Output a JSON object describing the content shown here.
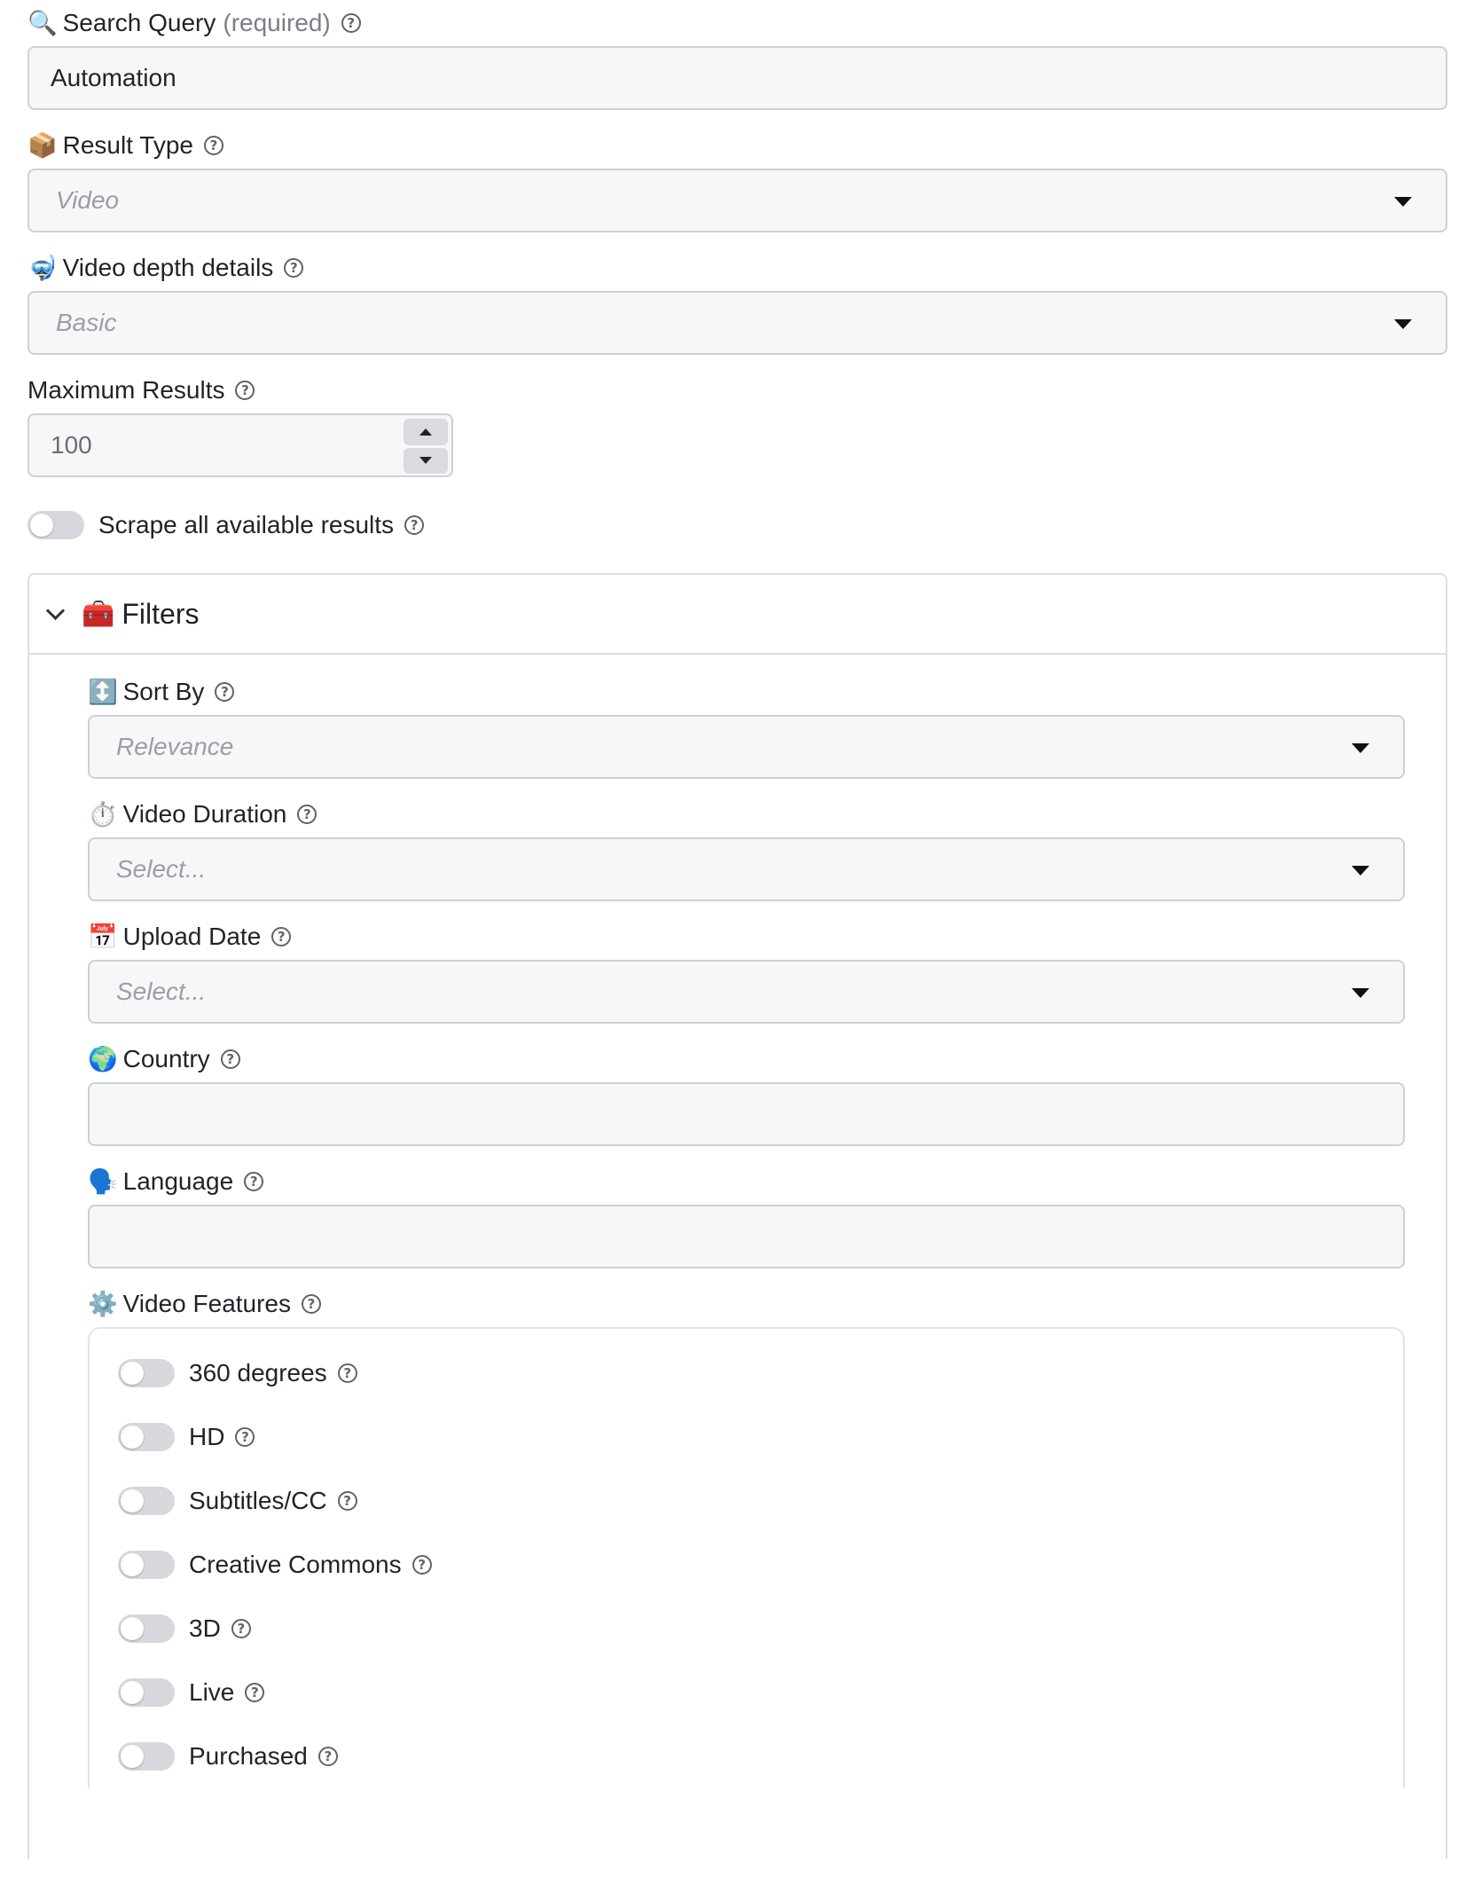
{
  "search_query": {
    "icon": "🔍",
    "label": "Search Query",
    "required_text": "(required)",
    "value": "Automation"
  },
  "result_type": {
    "icon": "📦",
    "label": "Result Type",
    "placeholder": "Video"
  },
  "video_depth": {
    "icon": "🤿",
    "label": "Video depth details",
    "placeholder": "Basic"
  },
  "max_results": {
    "label": "Maximum Results",
    "value": "100"
  },
  "scrape_all": {
    "label": "Scrape all available results",
    "enabled": false
  },
  "filters": {
    "icon": "🧰",
    "title": "Filters",
    "sort_by": {
      "icon": "↕️",
      "label": "Sort By",
      "placeholder": "Relevance"
    },
    "video_duration": {
      "icon": "⏱️",
      "label": "Video Duration",
      "placeholder": "Select..."
    },
    "upload_date": {
      "icon": "📅",
      "label": "Upload Date",
      "placeholder": "Select..."
    },
    "country": {
      "icon": "🌍",
      "label": "Country",
      "value": ""
    },
    "language": {
      "icon": "🗣️",
      "label": "Language",
      "value": ""
    },
    "video_features": {
      "icon": "⚙️",
      "label": "Video Features",
      "items": [
        {
          "label": "360 degrees",
          "enabled": false
        },
        {
          "label": "HD",
          "enabled": false
        },
        {
          "label": "Subtitles/CC",
          "enabled": false
        },
        {
          "label": "Creative Commons",
          "enabled": false
        },
        {
          "label": "3D",
          "enabled": false
        },
        {
          "label": "Live",
          "enabled": false
        },
        {
          "label": "Purchased",
          "enabled": false
        }
      ]
    }
  },
  "colors": {
    "input_bg": "#f7f7f9",
    "input_border": "#cdd0d5",
    "toggle_off": "#d6d8dd",
    "placeholder": "#9a9ea6"
  }
}
